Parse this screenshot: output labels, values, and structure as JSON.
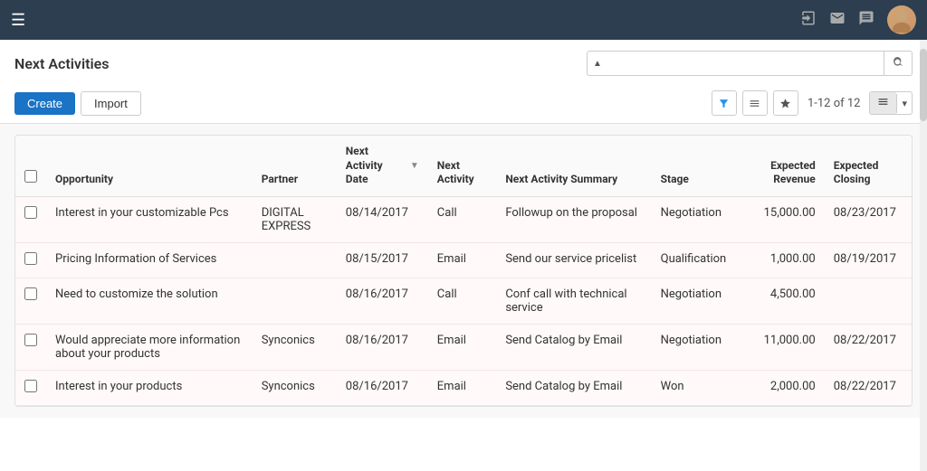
{
  "topbar": {
    "hamburger": "☰",
    "icons": {
      "login": "→",
      "mail": "✉",
      "chat": "💬"
    },
    "avatar_emoji": "👤"
  },
  "header": {
    "title": "Next Activities",
    "search_placeholder": "",
    "search_dropdown_arrow": "▲"
  },
  "toolbar": {
    "create_label": "Create",
    "import_label": "Import",
    "filter_icon": "▼",
    "list_icon": "≡",
    "star_icon": "★",
    "pagination": "1-12 of 12",
    "view_list_icon": "≡",
    "view_dropdown_arrow": "▾"
  },
  "table": {
    "columns": [
      {
        "id": "checkbox",
        "label": ""
      },
      {
        "id": "opportunity",
        "label": "Opportunity"
      },
      {
        "id": "partner",
        "label": "Partner"
      },
      {
        "id": "activity_date",
        "label": "Next Activity Date",
        "sortable": true
      },
      {
        "id": "activity",
        "label": "Next Activity"
      },
      {
        "id": "activity_summary",
        "label": "Next Activity Summary"
      },
      {
        "id": "stage",
        "label": "Stage"
      },
      {
        "id": "revenue",
        "label": "Expected Revenue"
      },
      {
        "id": "closing",
        "label": "Expected Closing"
      }
    ],
    "rows": [
      {
        "opportunity": "Interest in your customizable Pcs",
        "partner": "DIGITAL EXPRESS",
        "activity_date": "08/14/2017",
        "activity": "Call",
        "activity_summary": "Followup on the proposal",
        "stage": "Negotiation",
        "revenue": "15,000.00",
        "closing": "08/23/2017"
      },
      {
        "opportunity": "Pricing Information of Services",
        "partner": "",
        "activity_date": "08/15/2017",
        "activity": "Email",
        "activity_summary": "Send our service pricelist",
        "stage": "Qualification",
        "revenue": "1,000.00",
        "closing": "08/19/2017"
      },
      {
        "opportunity": "Need to customize the solution",
        "partner": "",
        "activity_date": "08/16/2017",
        "activity": "Call",
        "activity_summary": "Conf call with technical service",
        "stage": "Negotiation",
        "revenue": "4,500.00",
        "closing": ""
      },
      {
        "opportunity": "Would appreciate more information about your products",
        "partner": "Synconics",
        "activity_date": "08/16/2017",
        "activity": "Email",
        "activity_summary": "Send Catalog by Email",
        "stage": "Negotiation",
        "revenue": "11,000.00",
        "closing": "08/22/2017"
      },
      {
        "opportunity": "Interest in your products",
        "partner": "Synconics",
        "activity_date": "08/16/2017",
        "activity": "Email",
        "activity_summary": "Send Catalog by Email",
        "stage": "Won",
        "revenue": "2,000.00",
        "closing": "08/22/2017"
      }
    ]
  }
}
